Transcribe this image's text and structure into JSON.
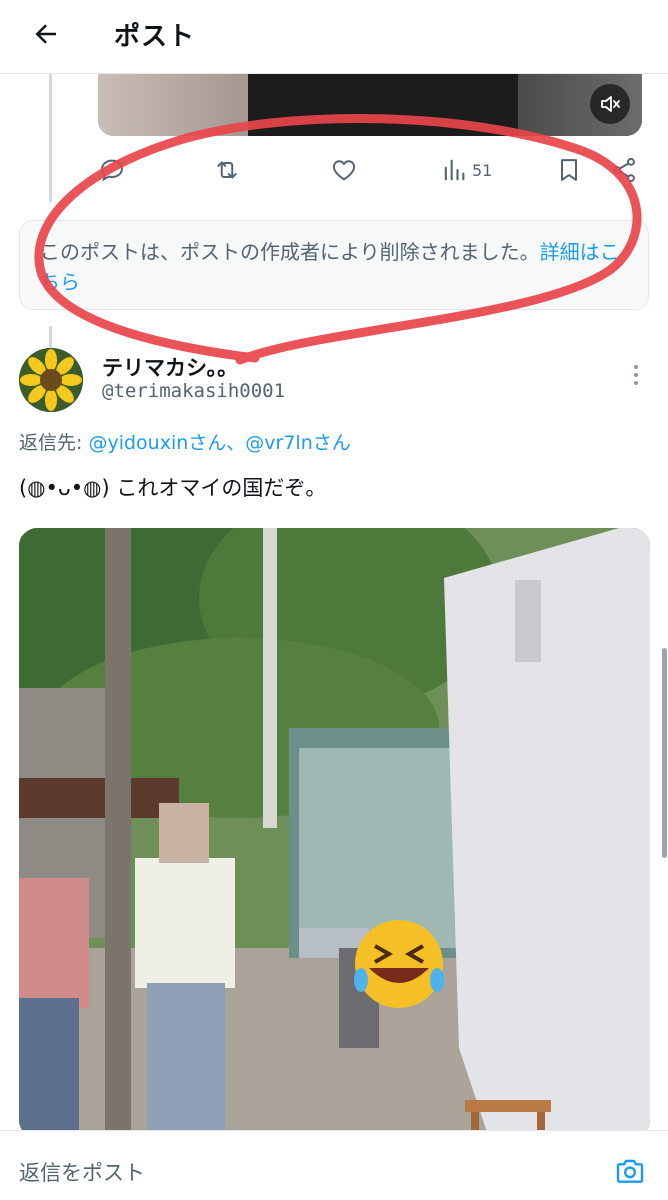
{
  "header": {
    "title": "ポスト"
  },
  "previous_post": {
    "actions": {
      "views_count": "51"
    }
  },
  "deleted_notice": {
    "text": "このポストは、ポストの作成者により削除されました。",
    "link_text": "詳細はこちら"
  },
  "reply_post": {
    "display_name": "テリマカシ。。",
    "handle": "@terimakasih0001",
    "reply_to_label": "返信先: ",
    "mentions": "@yidouxinさん、@vr7lnさん",
    "text": "(◍•ᴗ•◍) これオマイの国だぞ。"
  },
  "composer": {
    "placeholder": "返信をポスト"
  },
  "colors": {
    "accent": "#1d9bf0",
    "secondary_text": "#536471",
    "annotation_red": "#e8454b"
  },
  "icons": [
    "back-arrow-icon",
    "mute-icon",
    "reply-icon",
    "retweet-icon",
    "like-icon",
    "views-icon",
    "bookmark-icon",
    "share-icon",
    "more-icon",
    "camera-icon"
  ]
}
